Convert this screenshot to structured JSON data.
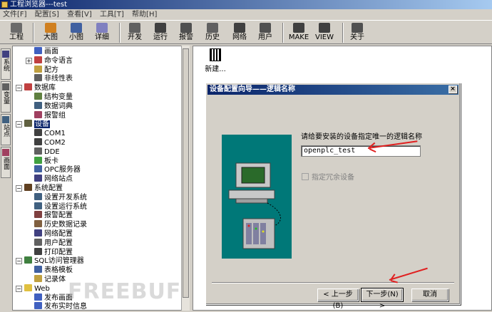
{
  "window": {
    "title": "工程浏览器---test"
  },
  "menu": [
    "文件[F]",
    "配置[S]",
    "查看[V]",
    "工具[T]",
    "帮助[H]"
  ],
  "toolbar": {
    "items": [
      {
        "label": "工程",
        "icon": "project-icon",
        "color": "#6a6a6a"
      },
      {
        "label": "大图",
        "icon": "large-icon",
        "color": "#d08020"
      },
      {
        "label": "小图",
        "icon": "small-icon",
        "color": "#4060a0"
      },
      {
        "label": "详细",
        "icon": "detail-icon",
        "color": "#8080c0"
      },
      {
        "label": "开发",
        "icon": "develop-icon",
        "color": "#606060"
      },
      {
        "label": "运行",
        "icon": "run-icon",
        "color": "#404040"
      },
      {
        "label": "报警",
        "icon": "alarm-icon",
        "color": "#505050"
      },
      {
        "label": "历史",
        "icon": "history-icon",
        "color": "#606060"
      },
      {
        "label": "网络",
        "icon": "network-icon",
        "color": "#404040"
      },
      {
        "label": "用户",
        "icon": "user-icon",
        "color": "#505050"
      },
      {
        "label": "MAKE",
        "icon": "make-icon",
        "color": "#404040"
      },
      {
        "label": "VIEW",
        "icon": "view-icon",
        "color": "#404040"
      },
      {
        "label": "关于",
        "icon": "about-icon",
        "color": "#505050"
      }
    ]
  },
  "side_tabs": [
    "系统",
    "变量",
    "站点",
    "画面"
  ],
  "tree": [
    {
      "label": "画面",
      "level": 2,
      "color": "#4060c0"
    },
    {
      "label": "命令语言",
      "level": 2,
      "color": "#c04040",
      "expand": "+"
    },
    {
      "label": "配方",
      "level": 2,
      "color": "#c0a040"
    },
    {
      "label": "非线性表",
      "level": 2,
      "color": "#606060"
    },
    {
      "label": "数据库",
      "level": 1,
      "color": "#c04040",
      "expand": "−"
    },
    {
      "label": "结构变量",
      "level": 2,
      "color": "#608040"
    },
    {
      "label": "数据词典",
      "level": 2,
      "color": "#406080"
    },
    {
      "label": "报警组",
      "level": 2,
      "color": "#a04060"
    },
    {
      "label": "设备",
      "level": 1,
      "color": "#606040",
      "expand": "−",
      "selected": true
    },
    {
      "label": "COM1",
      "level": 2,
      "color": "#404040"
    },
    {
      "label": "COM2",
      "level": 2,
      "color": "#404040"
    },
    {
      "label": "DDE",
      "level": 2,
      "color": "#606060"
    },
    {
      "label": "板卡",
      "level": 2,
      "color": "#40a040"
    },
    {
      "label": "OPC服务器",
      "level": 2,
      "color": "#4060a0"
    },
    {
      "label": "网络站点",
      "level": 2,
      "color": "#404080"
    },
    {
      "label": "系统配置",
      "level": 1,
      "color": "#604020",
      "expand": "−"
    },
    {
      "label": "设置开发系统",
      "level": 2,
      "color": "#406080"
    },
    {
      "label": "设置运行系统",
      "level": 2,
      "color": "#406080"
    },
    {
      "label": "报警配置",
      "level": 2,
      "color": "#804040"
    },
    {
      "label": "历史数据记录",
      "level": 2,
      "color": "#806040"
    },
    {
      "label": "网络配置",
      "level": 2,
      "color": "#404080"
    },
    {
      "label": "用户配置",
      "level": 2,
      "color": "#606060"
    },
    {
      "label": "打印配置",
      "level": 2,
      "color": "#404040"
    },
    {
      "label": "SQL访问管理器",
      "level": 1,
      "color": "#408040",
      "expand": "−"
    },
    {
      "label": "表格模板",
      "level": 2,
      "color": "#4060a0"
    },
    {
      "label": "记录体",
      "level": 2,
      "color": "#c0a040"
    },
    {
      "label": "Web",
      "level": 1,
      "color": "#e0c040",
      "expand": "−"
    },
    {
      "label": "发布画面",
      "level": 2,
      "color": "#4060c0"
    },
    {
      "label": "发布实时信息",
      "level": 2,
      "color": "#4060c0"
    }
  ],
  "content": {
    "new_item_label": "新建..."
  },
  "dialog": {
    "title": "设备配置向导——逻辑名称",
    "close": "×",
    "prompt": "请给要安装的设备指定唯一的逻辑名称",
    "name_value": "openplc_test",
    "redundant_checkbox": "指定冗余设备",
    "back": "< 上一步(B)",
    "next": "下一步(N) >",
    "cancel": "取消"
  },
  "watermark": "FREEBUF"
}
